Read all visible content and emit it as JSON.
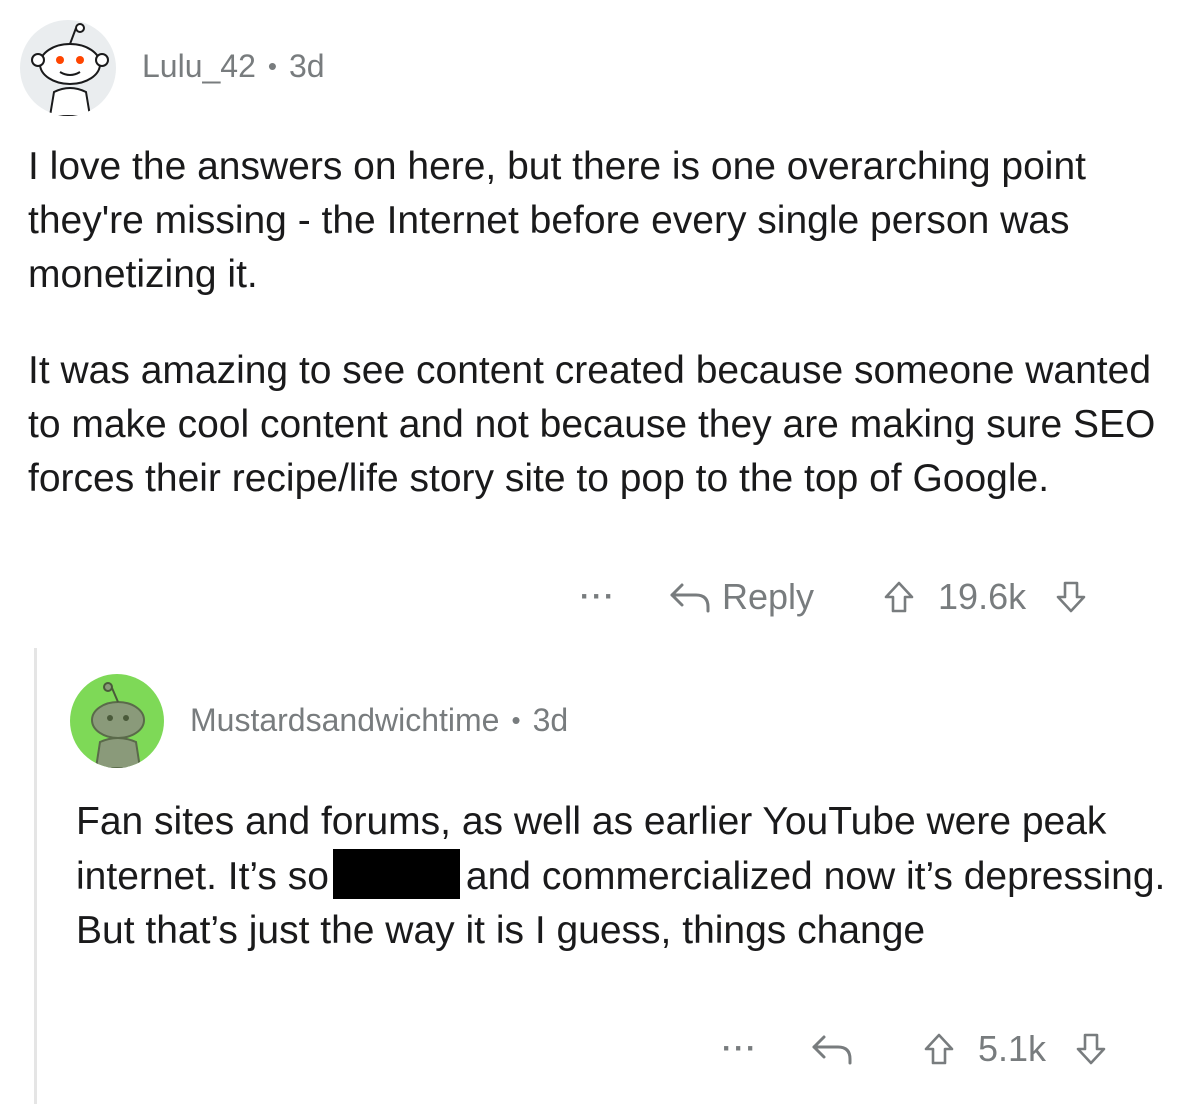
{
  "comments": [
    {
      "username": "Lulu_42",
      "separator": "•",
      "age": "3d",
      "paragraphs": [
        "I love the answers on here, but there is one overarching point they're missing - the Internet before every single person was monetizing it.",
        "It was amazing to see content created because someone wanted to make cool content and not because they are making sure SEO forces their recipe/life story site to pop to the top of Google."
      ],
      "more_label": "···",
      "reply_label": "Reply",
      "score": "19.6k"
    },
    {
      "username": "Mustardsandwichtime",
      "separator": "•",
      "age": "3d",
      "text_before_redaction": "Fan sites and forums, as well as earlier YouTube were peak internet. It’s so",
      "text_after_redaction": "and commercialized now it’s depressing. But that’s just the way it is I guess, things change",
      "more_label": "···",
      "score": "5.1k"
    }
  ],
  "colors": {
    "text": "#1a1a1b",
    "meta": "#787c7e",
    "avatar1_bg": "#eaedef",
    "avatar2_bg": "#7ed957",
    "redaction": "#000000",
    "thread_line": "#e5e5e5"
  },
  "icons": {
    "reply": "reply-arrow-icon",
    "upvote": "upvote-arrow-icon",
    "downvote": "downvote-arrow-icon",
    "more": "more-options-icon"
  }
}
